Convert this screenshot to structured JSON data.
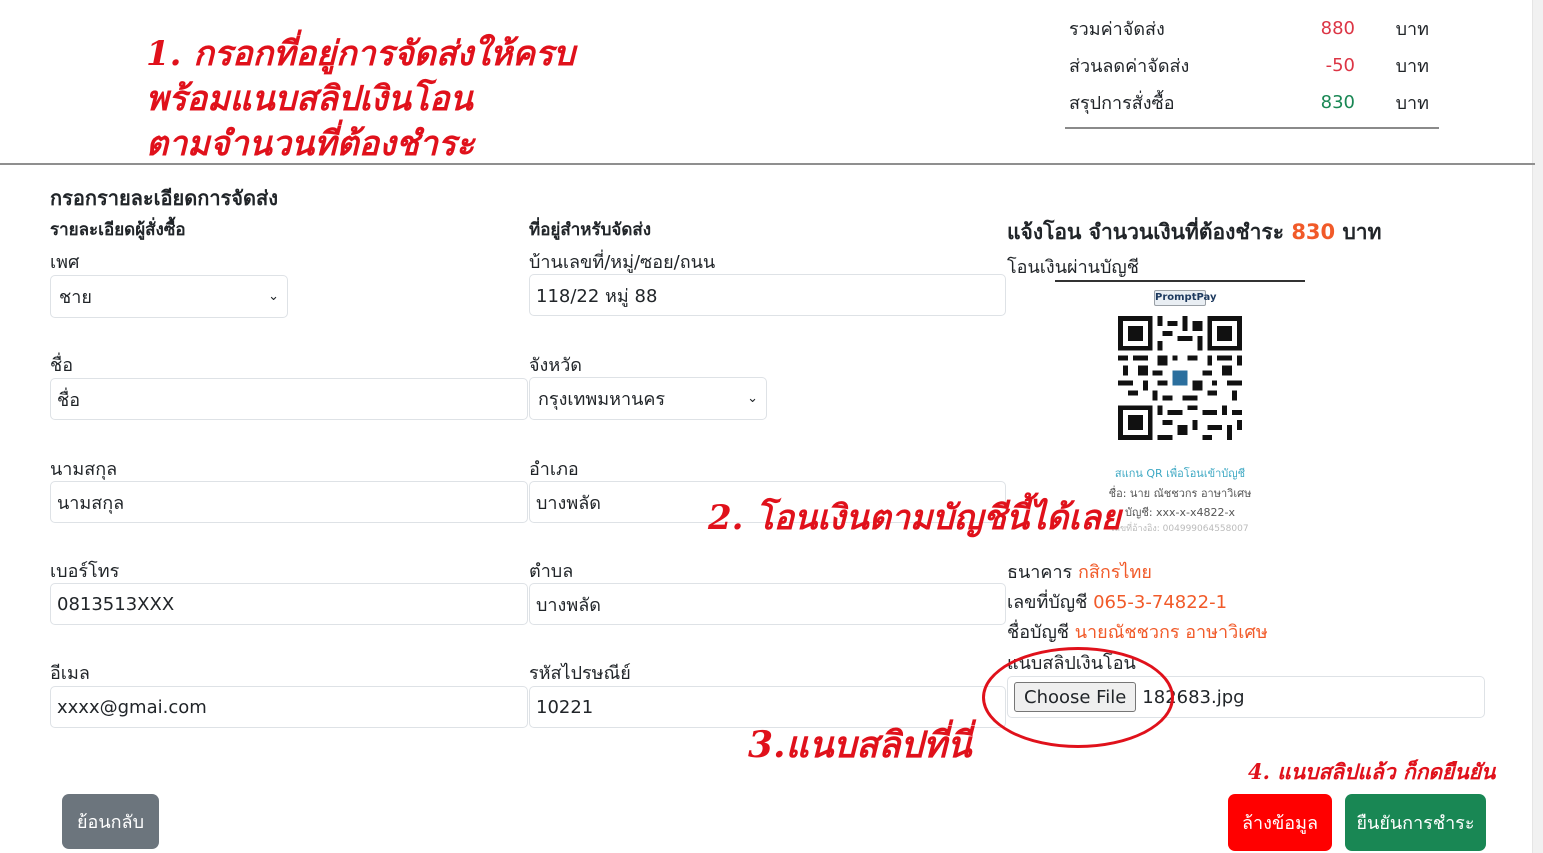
{
  "annotations": {
    "step1_lines": [
      "1. กรอกที่อยู่การจัดส่งให้ครบ",
      "พร้อมแนบสลิปเงินโอน",
      "ตามจำนวนที่ต้องชำระ"
    ],
    "step2": "2. โอนเงินตามบัญชีนี้ได้เลย",
    "step3": "3.แนบสลิปที่นี่",
    "step4": "4. แนบสลิปแล้ว ก็กดยืนยัน"
  },
  "summary": {
    "rows": [
      {
        "label": "รวมค่าจัดส่ง",
        "value": "880",
        "unit": "บาท"
      },
      {
        "label": "ส่วนลดค่าจัดส่ง",
        "value": "-50",
        "unit": "บาท"
      },
      {
        "label": "สรุปการสั่งซื้อ",
        "value": "830",
        "unit": "บาท"
      }
    ]
  },
  "form": {
    "title": "กรอกรายละเอียดการจัดส่ง",
    "buyer_header": "รายละเอียดผู้สั่งซื้อ",
    "address_header": "ที่อยู่สำหรับจัดส่ง",
    "gender": {
      "label": "เพศ",
      "value": "ชาย"
    },
    "first_name": {
      "label": "ชื่อ",
      "value": "ชื่อ"
    },
    "last_name": {
      "label": "นามสกุล",
      "value": "นามสกุล"
    },
    "phone": {
      "label": "เบอร์โทร",
      "value": "0813513XXX"
    },
    "email": {
      "label": "อีเมล",
      "value": "xxxx@gmai.com"
    },
    "address": {
      "label": "บ้านเลขที่/หมู่/ซอย/ถนน",
      "value": "118/22 หมู่ 88"
    },
    "province": {
      "label": "จังหวัด",
      "value": "กรุงเทพมหานคร"
    },
    "district": {
      "label": "อำเภอ",
      "value": "บางพลัด"
    },
    "subdistrict": {
      "label": "ตำบล",
      "value": "บางพลัด"
    },
    "postcode": {
      "label": "รหัสไปรษณีย์",
      "value": "10221"
    }
  },
  "payment": {
    "title_prefix": "แจ้งโอน จำนวนเงินที่ต้องชำระ",
    "amount": "830",
    "title_suffix": "บาท",
    "subtitle": "โอนเงินผ่านบัญชี",
    "promptpay_logo": "PromptPay",
    "qr_scan_text": "สแกน QR เพื่อโอนเข้าบัญชี",
    "qr_name_text": "ชื่อ: นาย ณัชชวกร อาษาวิเศษ",
    "qr_account_text": "บัญชี: xxx-x-x4822-x",
    "qr_ref_text": "เลขที่อ้างอิง: 004999064558007",
    "bank_label": "ธนาคาร",
    "bank_name": "กสิกรไทย",
    "account_no_label": "เลขที่บัญชี",
    "account_no": "065-3-74822-1",
    "account_name_label": "ชื่อบัญชี",
    "account_name": "นายณัชชวกร อาษาวิเศษ",
    "slip_label": "แนบสลิปเงินโอน",
    "choose_file_label": "Choose File",
    "file_name": "182683.jpg"
  },
  "buttons": {
    "back": "ย้อนกลับ",
    "clear": "ล้างข้อมูล",
    "confirm": "ยืนยันการชำระ"
  },
  "colors": {
    "accent_orange": "#f15a29",
    "annotation_red": "#e0111b",
    "confirm_green": "#198754",
    "clear_red": "#ff0000",
    "back_gray": "#6c757d"
  }
}
